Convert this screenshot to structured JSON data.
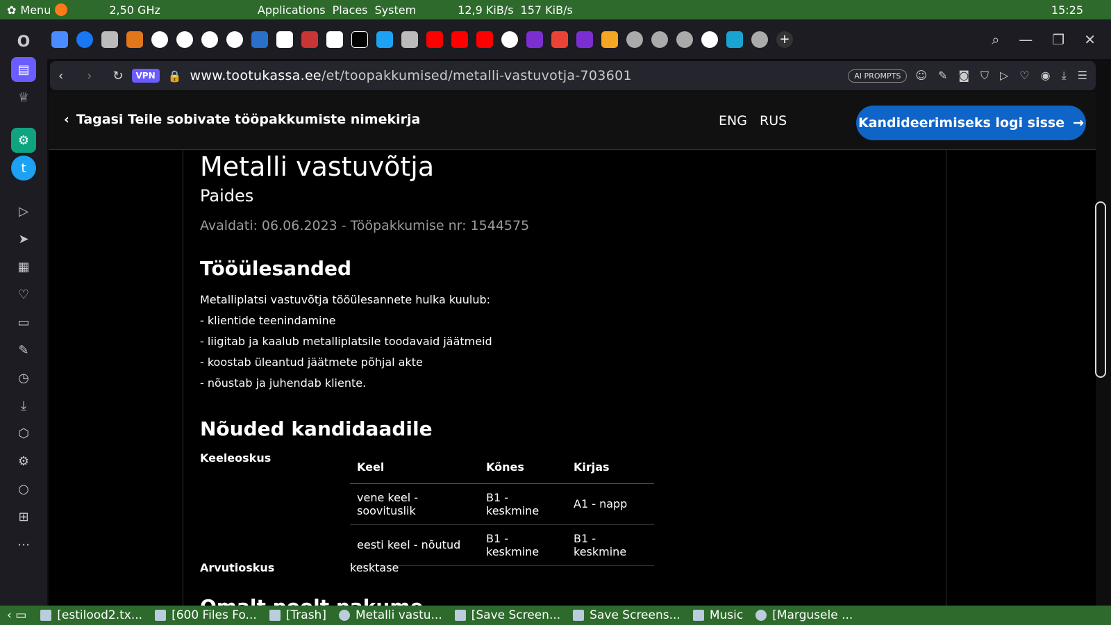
{
  "top_panel": {
    "menu": "Menu",
    "cpu": "2,50 GHz",
    "applications": "Applications",
    "places": "Places",
    "system": "System",
    "net_down": "12,9 KiB/s",
    "net_up": "157 KiB/s",
    "clock": "15:25"
  },
  "tabs": [
    "Opera",
    "Facebook",
    "Bank",
    "MetaMask",
    "Google",
    "Google",
    "Google",
    "Google",
    "RT",
    "EMI",
    "App",
    "Wikipedia",
    "Medium",
    "Twitter",
    "Bank",
    "YouTube",
    "YouTube",
    "YouTube",
    "Google",
    "Mail",
    "Gmail",
    "Mail",
    "M",
    "World",
    "World",
    "World",
    "Google",
    "Cloud",
    "World"
  ],
  "address": {
    "vpn": "VPN",
    "url_host": "www.tootukassa.ee",
    "url_path": "/et/toopakkumised/metalli-vastuvotja-703601",
    "ai_prompts": "AI PROMPTS"
  },
  "site": {
    "back": "Tagasi Teile sobivate tööpakkumiste nimekirja",
    "lang_eng": "ENG",
    "lang_rus": "RUS",
    "login": "Kandideerimiseks logi sisse"
  },
  "job": {
    "title": "Metalli vastuvõtja",
    "location": "Paides",
    "meta": "Avaldati: 06.06.2023 - Tööpakkumise nr: 1544575",
    "tasks_heading": "Tööülesanded",
    "tasks": [
      "Metalliplatsi vastuvõtja tööülesannete hulka kuulub:",
      "- klientide teenindamine",
      "- liigitab ja kaalub metalliplatsile toodavaid jäätmeid",
      "- koostab üleantud jäätmete põhjal akte",
      "- nõustab ja juhendab kliente."
    ],
    "req_heading": "Nõuded kandidaadile",
    "lang_label": "Keeleoskus",
    "table_headers": [
      "Keel",
      "Kõnes",
      "Kirjas"
    ],
    "table_rows": [
      [
        "vene keel - soovituslik",
        "B1 - keskmine",
        "A1 - napp"
      ],
      [
        "eesti keel - nõutud",
        "B1 - keskmine",
        "B1 - keskmine"
      ]
    ],
    "comp_label": "Arvutioskus",
    "comp_value": "kesktase",
    "next_heading": "Omalt poolt pakume"
  },
  "taskbar": [
    "[estilood2.tx...",
    "[600 Files Fo...",
    "[Trash]",
    "Metalli vastu...",
    "[Save Screen...",
    "Save Screens...",
    "Music",
    "[Margusele ..."
  ]
}
